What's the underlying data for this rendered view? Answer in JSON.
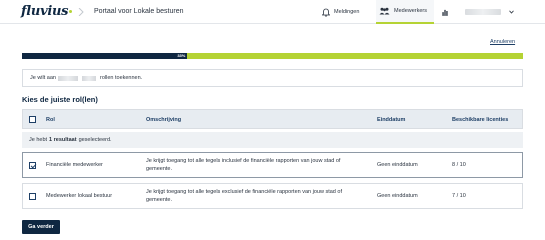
{
  "header": {
    "logo_text": "fluvius",
    "portal_title": "Portaal voor Lokale besturen",
    "nav": {
      "meldingen_label": "Meldingen",
      "medewerkers_label": "Medewerkers"
    },
    "icons": [
      "chevron-right-icon",
      "bell-icon",
      "people-icon",
      "bar-chart-icon",
      "chevron-down-icon"
    ]
  },
  "cancel_label": "Annuleren",
  "progress": {
    "percent": 33,
    "label": "33%"
  },
  "info": {
    "prefix": "Je wilt aan",
    "suffix": "rollen toekennen."
  },
  "section_title": "Kies de juiste rol(len)",
  "table": {
    "headers": {
      "rol": "Rol",
      "omschrijving": "Omschrijving",
      "einddatum": "Einddatum",
      "licenties": "Beschikbare licenties"
    },
    "selected_text": {
      "prefix": "Je hebt",
      "bold": "1 resultaat",
      "suffix": "geselecteerd."
    },
    "rows": [
      {
        "rol": "Financiële medewerker",
        "omschrijving": "Je krijgt toegang tot alle tegels inclusief de financiële rapporten van jouw stad of gemeente.",
        "einddatum": "Geen einddatum",
        "licenties": "8 / 10",
        "checked": true
      },
      {
        "rol": "Medewerker lokaal bestuur",
        "omschrijving": "Je krijgt toegang tot alle tegels exclusief de financiële rapporten van jouw stad of gemeente.",
        "einddatum": "Geen einddatum",
        "licenties": "7 / 10",
        "checked": false
      }
    ]
  },
  "next_button_label": "Ga verder",
  "colors": {
    "navy": "#0f2741",
    "lime": "#b5d334",
    "header_bg": "#e7ecf1"
  }
}
